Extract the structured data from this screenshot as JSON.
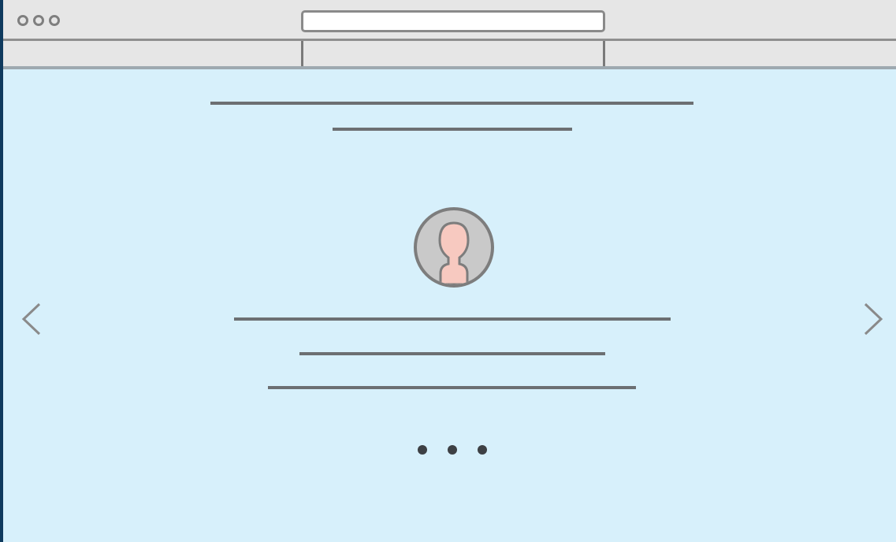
{
  "window": {
    "title_bar": {
      "traffic_lights": [
        "close",
        "minimize",
        "maximize"
      ],
      "address_value": ""
    }
  },
  "carousel": {
    "avatar_icon": "user-avatar-icon",
    "prev_icon": "chevron-left-icon",
    "next_icon": "chevron-right-icon",
    "slide_count": 3,
    "active_slide": 1
  },
  "colors": {
    "page_background": "#d7f0fb",
    "chrome": "#e6e6e6",
    "placeholder_line": "#6c6f72",
    "avatar_skin": "#f7c9c0"
  }
}
